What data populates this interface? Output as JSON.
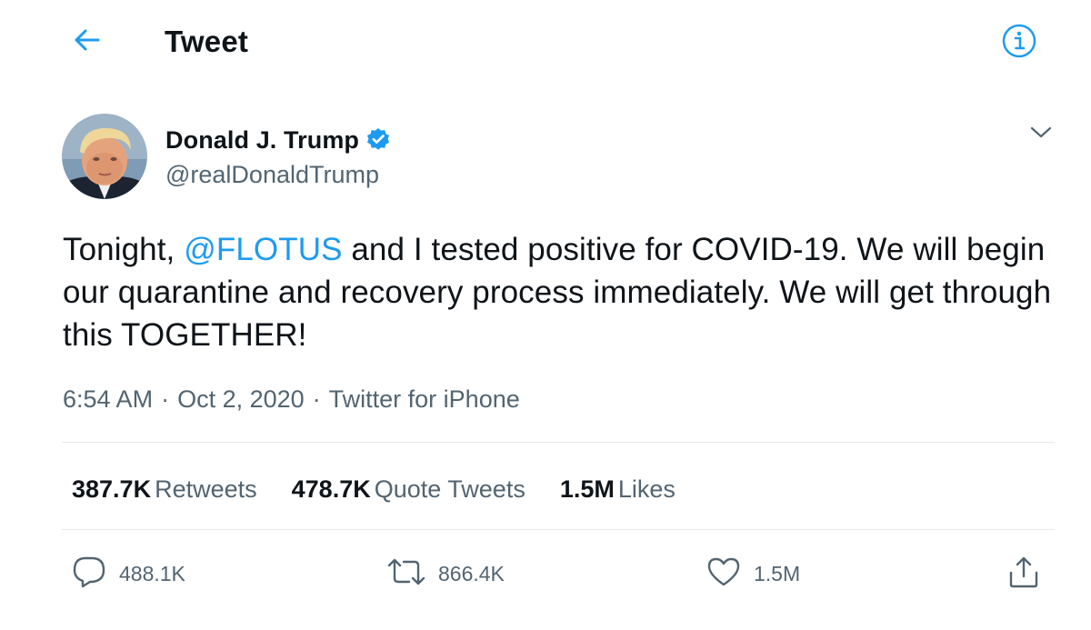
{
  "header": {
    "title": "Tweet",
    "back_icon": "arrow-left-icon",
    "info_icon": "info-circle-icon",
    "accent": "#1d9bf0"
  },
  "author": {
    "name": "Donald J. Trump",
    "handle": "@realDonaldTrump",
    "verified_icon": "verified-badge-icon",
    "more_icon": "chevron-down-icon"
  },
  "tweet": {
    "text_before": "Tonight, ",
    "mention": "@FLOTUS",
    "text_after": " and I tested positive for COVID-19. We will begin our quarantine and recovery process immediately. We will get through this TOGETHER!"
  },
  "meta": {
    "time": "6:54 AM",
    "date": "Oct 2, 2020",
    "source": "Twitter for iPhone",
    "separator": "·"
  },
  "stats": {
    "retweets_count": "387.7K",
    "retweets_label": "Retweets",
    "quotes_count": "478.7K",
    "quotes_label": "Quote Tweets",
    "likes_count": "1.5M",
    "likes_label": "Likes"
  },
  "actions": {
    "reply_count": "488.1K",
    "retweet_count": "866.4K",
    "like_count": "1.5M",
    "reply_icon": "reply-bubble-icon",
    "retweet_icon": "retweet-icon",
    "like_icon": "heart-icon",
    "share_icon": "share-icon"
  },
  "colors": {
    "text_primary": "#0f1419",
    "text_secondary": "#536471",
    "link": "#1d9bf0",
    "divider": "#e6e9eb"
  }
}
